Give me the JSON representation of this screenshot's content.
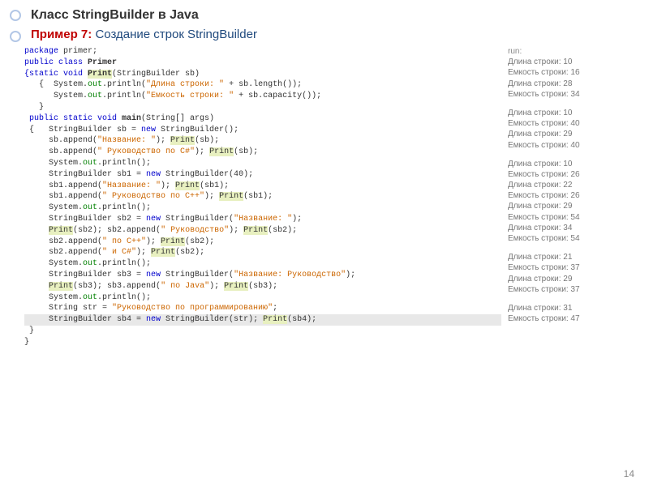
{
  "slide": {
    "title": "Класс StringBuilder в Java",
    "example_label": "Пример 7:",
    "example_desc": "Создание строк StringBuilder",
    "page_number": "14"
  },
  "code": {
    "l1a": "package",
    "l1b": " primer;",
    "l2a": "public class ",
    "l2b": "Primer",
    "l3a": "{static void ",
    "l3b": "Print",
    "l3c": "(StringBuilder sb)",
    "l4a": "   {  System.",
    "l4b": "out",
    "l4c": ".println(",
    "l4d": "\"Длина строки: \"",
    "l4e": " + sb.length());",
    "l5a": "      System.",
    "l5b": "out",
    "l5c": ".println(",
    "l5d": "\"Емкость строки: \"",
    "l5e": " + sb.capacity());",
    "l6": "   }",
    "l7a": " public static void ",
    "l7b": "main",
    "l7c": "(String[] args)",
    "l8a": " {   StringBuilder sb = ",
    "l8b": "new",
    "l8c": " StringBuilder();",
    "l9a": "     sb.append(",
    "l9b": "\"Название: \"",
    "l9c": "); ",
    "l9d": "Print",
    "l9e": "(sb);",
    "l10a": "     sb.append(",
    "l10b": "\" Руководство по C#\"",
    "l10c": "); ",
    "l10d": "Print",
    "l10e": "(sb);",
    "l11a": "     System.",
    "l11b": "out",
    "l11c": ".println();",
    "l12a": "     StringBuilder sb1 = ",
    "l12b": "new",
    "l12c": " StringBuilder(40);",
    "l13a": "     sb1.append(",
    "l13b": "\"Название: \"",
    "l13c": "); ",
    "l13d": "Print",
    "l13e": "(sb1);",
    "l14a": "     sb1.append(",
    "l14b": "\" Руководство по C++\"",
    "l14c": "); ",
    "l14d": "Print",
    "l14e": "(sb1);",
    "l15a": "     System.",
    "l15b": "out",
    "l15c": ".println();",
    "l16a": "     StringBuilder sb2 = ",
    "l16b": "new",
    "l16c": " StringBuilder(",
    "l16d": "\"Название: \"",
    "l16e": ");",
    "l17a": "     ",
    "l17b": "Print",
    "l17c": "(sb2); sb2.append(",
    "l17d": "\" Руководство\"",
    "l17e": "); ",
    "l17f": "Print",
    "l17g": "(sb2);",
    "l18a": "     sb2.append(",
    "l18b": "\" по C++\"",
    "l18c": "); ",
    "l18d": "Print",
    "l18e": "(sb2);",
    "l19a": "     sb2.append(",
    "l19b": "\" и C#\"",
    "l19c": "); ",
    "l19d": "Print",
    "l19e": "(sb2);",
    "l20a": "     System.",
    "l20b": "out",
    "l20c": ".println();",
    "l21a": "     StringBuilder sb3 = ",
    "l21b": "new",
    "l21c": " StringBuilder(",
    "l21d": "\"Название: Руководство\"",
    "l21e": ");",
    "l22a": "     ",
    "l22b": "Print",
    "l22c": "(sb3); sb3.append(",
    "l22d": "\" по Java\"",
    "l22e": "); ",
    "l22f": "Print",
    "l22g": "(sb3);",
    "l23a": "     System.",
    "l23b": "out",
    "l23c": ".println();",
    "l24a": "     String str = ",
    "l24b": "\"Руководство по программированию\"",
    "l24c": ";",
    "l25a": "     StringBuilder sb4 = ",
    "l25b": "new",
    "l25c": " StringBuilder(str); ",
    "l25d": "Print",
    "l25e": "(sb4);",
    "l26": " }",
    "l27": "}"
  },
  "output": {
    "run": "run:",
    "g1l1": "Длина строки: 10",
    "g1l2": "Емкость строки: 16",
    "g1l3": "Длина строки: 28",
    "g1l4": "Емкость строки: 34",
    "g2l1": "Длина строки: 10",
    "g2l2": "Емкость строки: 40",
    "g2l3": "Длина строки: 29",
    "g2l4": "Емкость строки: 40",
    "g3l1": "Длина строки: 10",
    "g3l2": "Емкость строки: 26",
    "g3l3": "Длина строки: 22",
    "g3l4": "Емкость строки: 26",
    "g3l5": "Длина строки: 29",
    "g3l6": "Емкость строки: 54",
    "g3l7": "Длина строки: 34",
    "g3l8": "Емкость строки: 54",
    "g4l1": "Длина строки: 21",
    "g4l2": "Емкость строки: 37",
    "g4l3": "Длина строки: 29",
    "g4l4": "Емкость строки: 37",
    "g5l1": "Длина строки: 31",
    "g5l2": "Емкость строки: 47"
  }
}
